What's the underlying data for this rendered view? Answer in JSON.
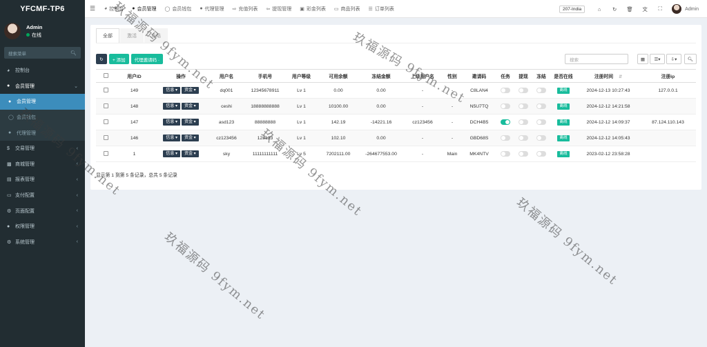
{
  "brand": "YFCMF-TP6",
  "user": {
    "name": "Admin",
    "status": "在线"
  },
  "sidebar": {
    "search_placeholder": "搜索菜单",
    "items": [
      {
        "label": "控制台",
        "icon": "dashboard-icon",
        "type": "top",
        "has_chevron": false
      },
      {
        "label": "会员管理",
        "icon": "user-icon",
        "type": "open",
        "has_chevron": true
      },
      {
        "label": "会员管理",
        "icon": "user-icon",
        "type": "sub-active",
        "has_chevron": false
      },
      {
        "label": "会员钱包",
        "icon": "circle-icon",
        "type": "sub",
        "has_chevron": false
      },
      {
        "label": "代理管理",
        "icon": "users-icon",
        "type": "sub",
        "has_chevron": false
      },
      {
        "label": "交易管理",
        "icon": "dollar-icon",
        "type": "top",
        "has_chevron": true
      },
      {
        "label": "商城管理",
        "icon": "shop-icon",
        "type": "top",
        "has_chevron": true
      },
      {
        "label": "报表管理",
        "icon": "chart-icon",
        "type": "top",
        "has_chevron": true
      },
      {
        "label": "支付配置",
        "icon": "card-icon",
        "type": "top",
        "has_chevron": true
      },
      {
        "label": "页面配置",
        "icon": "gear-icon",
        "type": "top",
        "has_chevron": true
      },
      {
        "label": "权限管理",
        "icon": "group-icon",
        "type": "top",
        "has_chevron": true
      },
      {
        "label": "系统管理",
        "icon": "cogs-icon",
        "type": "top",
        "has_chevron": true
      }
    ]
  },
  "topnav": {
    "tabs": [
      {
        "label": "控制台",
        "icon": "dashboard-icon",
        "active": false
      },
      {
        "label": "会员管理",
        "icon": "user-icon",
        "active": true
      },
      {
        "label": "会员钱包",
        "icon": "circle-icon",
        "active": false
      },
      {
        "label": "代理管理",
        "icon": "users-icon",
        "active": false
      },
      {
        "label": "充值列表",
        "icon": "login-icon",
        "active": false
      },
      {
        "label": "提现管理",
        "icon": "logout-icon",
        "active": false
      },
      {
        "label": "彩金列表",
        "icon": "gift-icon",
        "active": false
      },
      {
        "label": "商品列表",
        "icon": "desktop-icon",
        "active": false
      },
      {
        "label": "订单列表",
        "icon": "list-icon",
        "active": false
      }
    ],
    "region": "207-India",
    "user_name": "Admin"
  },
  "subtabs": [
    "全部",
    "激活",
    "冻结"
  ],
  "toolbar": {
    "add_label": "+ 添加",
    "agent_code_label": "代理邀请码 ·",
    "search_placeholder": "搜索"
  },
  "table": {
    "columns": [
      "",
      "用户ID",
      "操作",
      "用户名",
      "手机号",
      "用户等级",
      "可用余额",
      "冻结金额",
      "上级用户名",
      "性别",
      "邀请码",
      "任务",
      "提现",
      "冻结",
      "是否在线",
      "注册时间",
      "注册ip"
    ],
    "op_labels": [
      "信息 ▾",
      "资金 ▾"
    ],
    "online_label": "离线",
    "rows": [
      {
        "id": "149",
        "username": "dq001",
        "phone": "12345678911",
        "level": "Lv 1",
        "balance": "0.00",
        "frozen": "0.00",
        "parent": "-",
        "gender": "-",
        "invite": "C8LAN4",
        "task": false,
        "withdraw": false,
        "freeze": false,
        "reg_time": "2024-12-13 10:27:43",
        "reg_ip": "127.0.0.1"
      },
      {
        "id": "148",
        "username": "ceshi",
        "phone": "18888888888",
        "level": "Lv 1",
        "balance": "10100.00",
        "frozen": "0.00",
        "parent": "-",
        "gender": "-",
        "invite": "N5U7TQ",
        "task": false,
        "withdraw": false,
        "freeze": false,
        "reg_time": "2024-12-12 14:21:58",
        "reg_ip": ""
      },
      {
        "id": "147",
        "username": "asd123",
        "phone": "88888888",
        "level": "Lv 1",
        "balance": "142.19",
        "frozen": "-14221.16",
        "parent": "cz123456",
        "gender": "-",
        "invite": "DCH4B5",
        "task": true,
        "withdraw": false,
        "freeze": false,
        "reg_time": "2024-12-12 14:09:37",
        "reg_ip": "87.124.110.143"
      },
      {
        "id": "146",
        "username": "cz123456",
        "phone": "128123",
        "level": "Lv 1",
        "balance": "102.10",
        "frozen": "0.00",
        "parent": "-",
        "gender": "-",
        "invite": "GBD68S",
        "task": false,
        "withdraw": false,
        "freeze": false,
        "reg_time": "2024-12-12 14:05:43",
        "reg_ip": ""
      },
      {
        "id": "1",
        "username": "sky",
        "phone": "11111111111",
        "level": "Lv 5",
        "balance": "7202111.00",
        "frozen": "-264677553.00",
        "parent": "-",
        "gender": "Main",
        "invite": "MK4NTV",
        "task": false,
        "withdraw": false,
        "freeze": false,
        "reg_time": "2023-02-12 23:58:28",
        "reg_ip": ""
      }
    ]
  },
  "footer": "显示第 1 到第 5 条记录，总共 5 条记录",
  "watermarks": [
    "玖福源码 9fym.net",
    "玖福源码 9fym.net",
    "玖福源码 9fym.net",
    "玖福源码 9fym.net",
    "玖福源码 9fym.net",
    "玖福源码 9fym.net"
  ]
}
